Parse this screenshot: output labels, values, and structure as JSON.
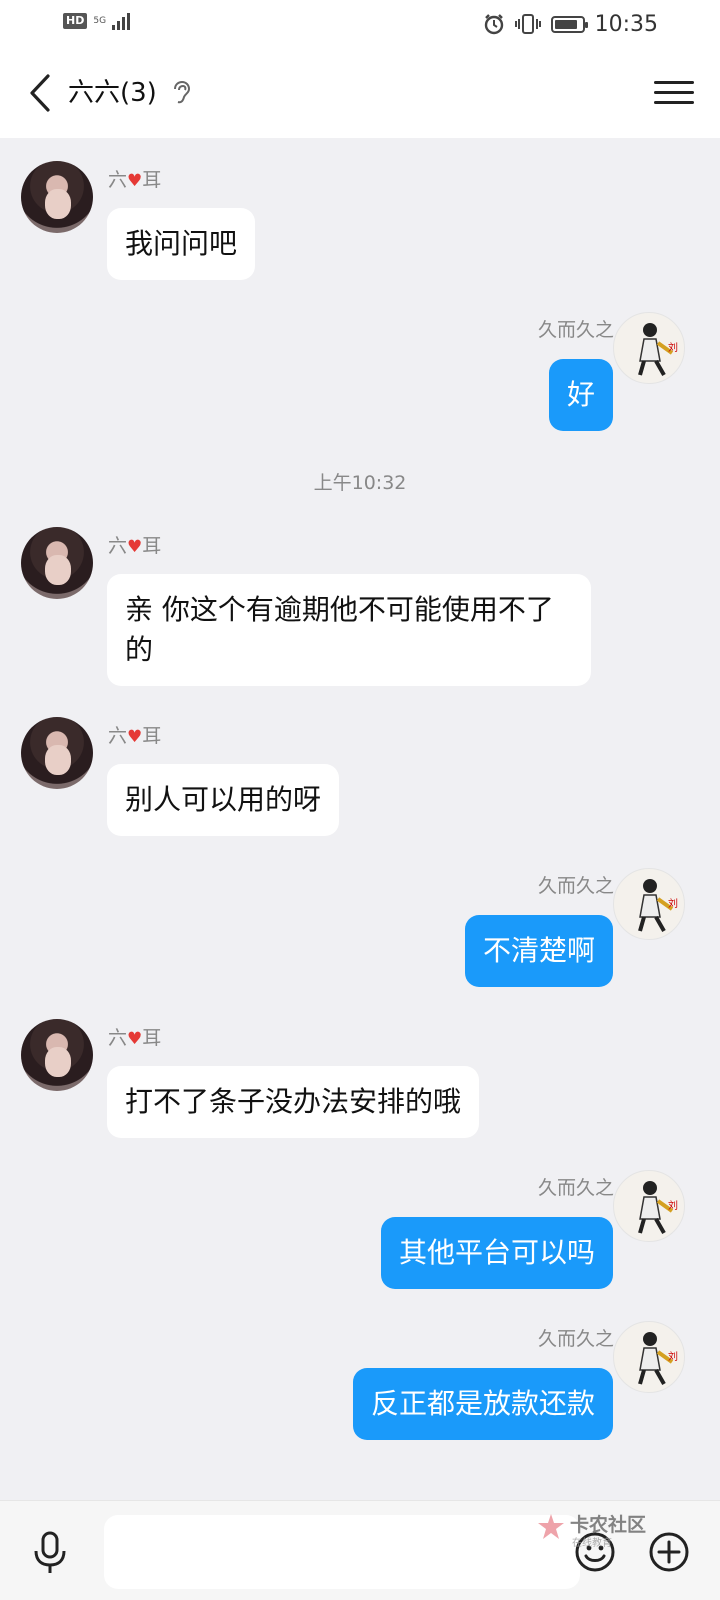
{
  "status_bar": {
    "hd": "HD",
    "network": "5G",
    "time": "10:35"
  },
  "nav": {
    "title": "六六(3)"
  },
  "messages": [
    {
      "sender": "六",
      "sender_suffix": "耳",
      "text": "我问问吧"
    },
    {
      "sender": "久而久之",
      "text": "好"
    },
    {
      "sender": "六",
      "sender_suffix": "耳",
      "text": "亲 你这个有逾期他不可能使用不了的"
    },
    {
      "sender": "六",
      "sender_suffix": "耳",
      "text": "别人可以用的呀"
    },
    {
      "sender": "久而久之",
      "text": "不清楚啊"
    },
    {
      "sender": "六",
      "sender_suffix": "耳",
      "text": "打不了条子没办法安排的哦"
    },
    {
      "sender": "久而久之",
      "text": "其他平台可以吗"
    },
    {
      "sender": "久而久之",
      "text": "反正都是放款还款"
    }
  ],
  "timestamp": "上午10:32",
  "input": {
    "value": ""
  },
  "watermark": {
    "main": "卡农社区",
    "sub": "在线教育"
  },
  "colors": {
    "outgoing_bubble": "#1a9afa",
    "incoming_bubble": "#ffffff",
    "background": "#f0f0f3"
  }
}
